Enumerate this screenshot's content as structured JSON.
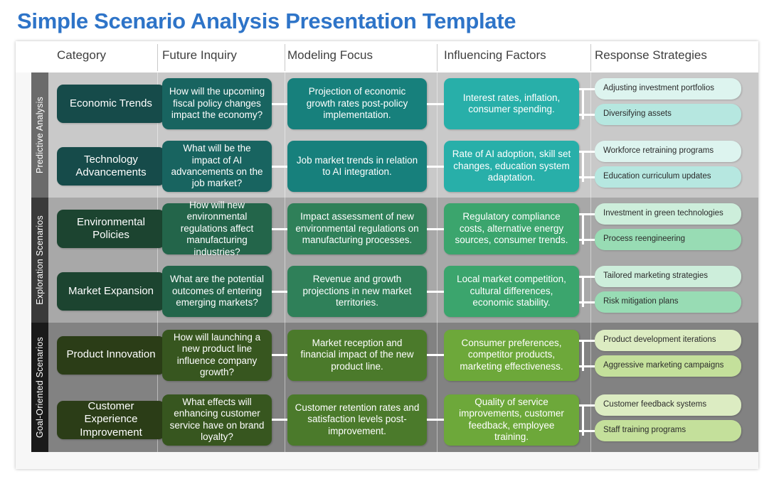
{
  "title": "Simple Scenario Analysis Presentation Template",
  "theme": {
    "title_color": "#2E74C8",
    "card_bg": "#f7f7f7",
    "header_bg": "#ffffff",
    "header_text": "#3f3f3f",
    "connector": "#ffffff"
  },
  "columns": [
    {
      "id": "category",
      "label": "Category"
    },
    {
      "id": "inquiry",
      "label": "Future Inquiry"
    },
    {
      "id": "modeling",
      "label": "Modeling Focus"
    },
    {
      "id": "influencing",
      "label": "Influencing Factors"
    },
    {
      "id": "response",
      "label": "Response Strategies"
    }
  ],
  "bands": [
    {
      "id": "predictive-analysis",
      "label": "Predictive Analysis",
      "tab_color": "#6b6b6b",
      "body_color": "#c9c9c9",
      "colors": {
        "category": "#164B4A",
        "inquiry": "#186460",
        "modeling": "#17807C",
        "influencing": "#28AFA9",
        "pill_light": "#ddf4ef",
        "pill_dark": "#b6e7e0"
      },
      "rows": [
        {
          "category": "Economic Trends",
          "inquiry": "How will the upcoming fiscal policy changes impact the economy?",
          "modeling": "Projection of economic growth rates post-policy implementation.",
          "influencing": "Interest rates, inflation, consumer spending.",
          "responses": [
            "Adjusting investment portfolios",
            "Diversifying assets"
          ]
        },
        {
          "category": "Technology Advancements",
          "inquiry": "What will be the impact of AI advancements on the job market?",
          "modeling": "Job market trends in relation to AI integration.",
          "influencing": "Rate of AI adoption, skill set changes, education system adaptation.",
          "responses": [
            "Workforce retraining programs",
            "Education curriculum updates"
          ]
        }
      ]
    },
    {
      "id": "exploration-scenarios",
      "label": "Exploration Scenarios",
      "tab_color": "#3a3a3a",
      "body_color": "#a8a8a8",
      "colors": {
        "category": "#1C4430",
        "inquiry": "#23654A",
        "modeling": "#2F8059",
        "influencing": "#3BA56D",
        "pill_light": "#cdeedb",
        "pill_dark": "#98dcb4"
      },
      "rows": [
        {
          "category": "Environmental Policies",
          "inquiry": "How will new environmental regulations affect manufacturing industries?",
          "modeling": "Impact assessment of new environmental regulations on manufacturing processes.",
          "influencing": "Regulatory compliance costs, alternative energy sources, consumer trends.",
          "responses": [
            "Investment in green technologies",
            "Process reengineering"
          ]
        },
        {
          "category": "Market Expansion",
          "inquiry": "What are the potential outcomes of entering emerging markets?",
          "modeling": "Revenue and growth projections in new market territories.",
          "influencing": "Local market competition, cultural differences, economic stability.",
          "responses": [
            "Tailored marketing strategies",
            "Risk mitigation plans"
          ]
        }
      ]
    },
    {
      "id": "goal-oriented-scenarios",
      "label": "Goal-Oriented Scenarios",
      "tab_color": "#1a1a1a",
      "body_color": "#828282",
      "colors": {
        "category": "#2B3D17",
        "inquiry": "#37561F",
        "modeling": "#4B7A2B",
        "influencing": "#6DA83A",
        "pill_light": "#dcecc2",
        "pill_dark": "#c4e09b"
      },
      "rows": [
        {
          "category": "Product Innovation",
          "inquiry": "How will launching a new product line influence company growth?",
          "modeling": "Market reception and financial impact of the new product line.",
          "influencing": "Consumer preferences, competitor products, marketing effectiveness.",
          "responses": [
            "Product development iterations",
            "Aggressive marketing campaigns"
          ]
        },
        {
          "category": "Customer Experience Improvement",
          "inquiry": "What effects will enhancing customer service have on brand loyalty?",
          "modeling": "Customer retention rates and satisfaction levels post-improvement.",
          "influencing": "Quality of service improvements, customer feedback, employee training.",
          "responses": [
            "Customer feedback systems",
            "Staff training programs"
          ]
        }
      ]
    }
  ]
}
